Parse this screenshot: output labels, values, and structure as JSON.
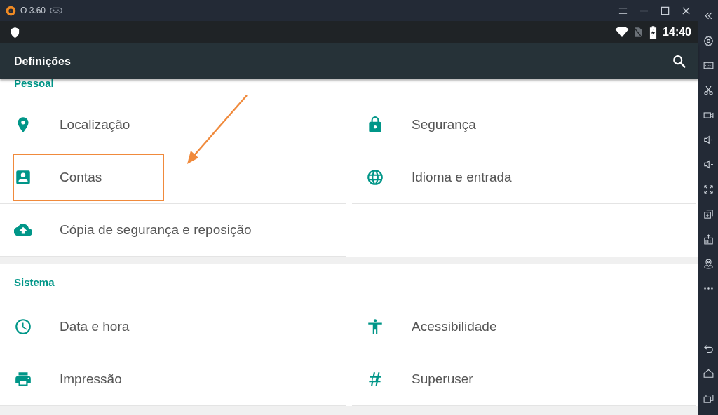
{
  "emulator": {
    "version": "O 3.60"
  },
  "status_bar": {
    "time": "14:40"
  },
  "toolbar": {
    "title": "Definições"
  },
  "sections": [
    {
      "title": "Pessoal",
      "items": [
        {
          "label": "Localização"
        },
        {
          "label": "Segurança"
        },
        {
          "label": "Contas"
        },
        {
          "label": "Idioma e entrada"
        },
        {
          "label": "Cópia de segurança e reposição"
        }
      ]
    },
    {
      "title": "Sistema",
      "items": [
        {
          "label": "Data e hora"
        },
        {
          "label": "Acessibilidade"
        },
        {
          "label": "Impressão"
        },
        {
          "label": "Superuser"
        }
      ]
    }
  ]
}
